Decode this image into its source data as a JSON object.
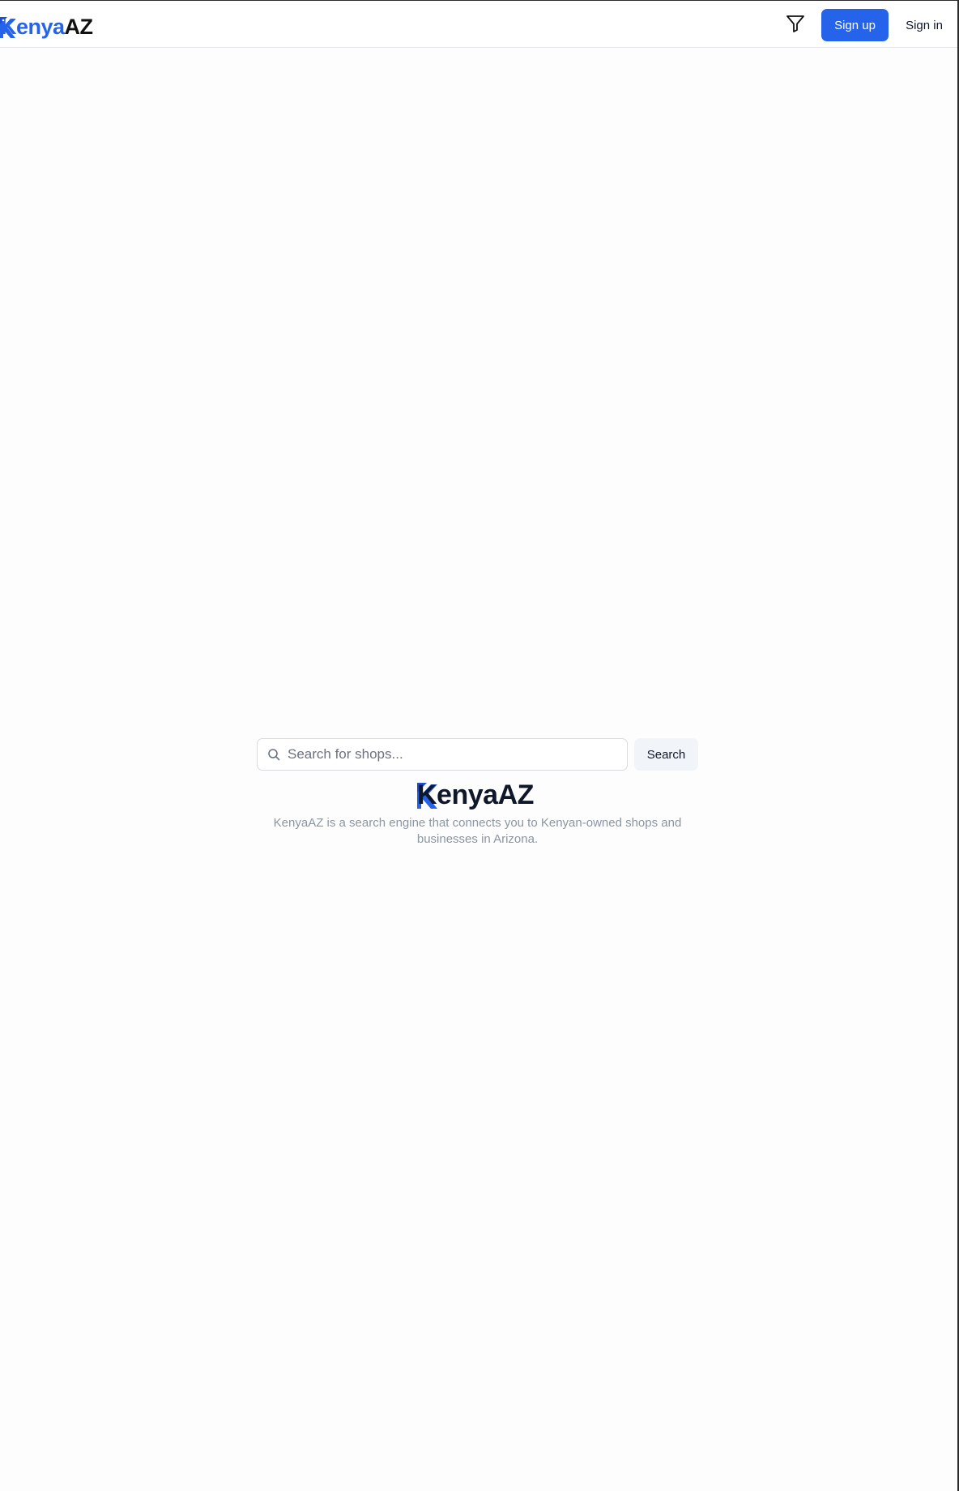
{
  "header": {
    "logo": {
      "k": "Kenya",
      "az": "AZ"
    },
    "filter_icon": "filter-icon",
    "signup_label": "Sign up",
    "signin_label": "Sign in"
  },
  "main": {
    "search": {
      "placeholder": "Search for shops...",
      "value": "",
      "icon": "search-icon",
      "button_label": "Search"
    },
    "logo": {
      "k": "Kenya",
      "az": "AZ"
    },
    "tagline": "KenyaAZ is a search engine that connects you to Kenyan-owned shops and businesses in Arizona."
  },
  "colors": {
    "brand_blue": "#2563eb",
    "text_dark": "#0f172a",
    "muted": "#8c95a3",
    "button_secondary": "#f1f5f9"
  }
}
